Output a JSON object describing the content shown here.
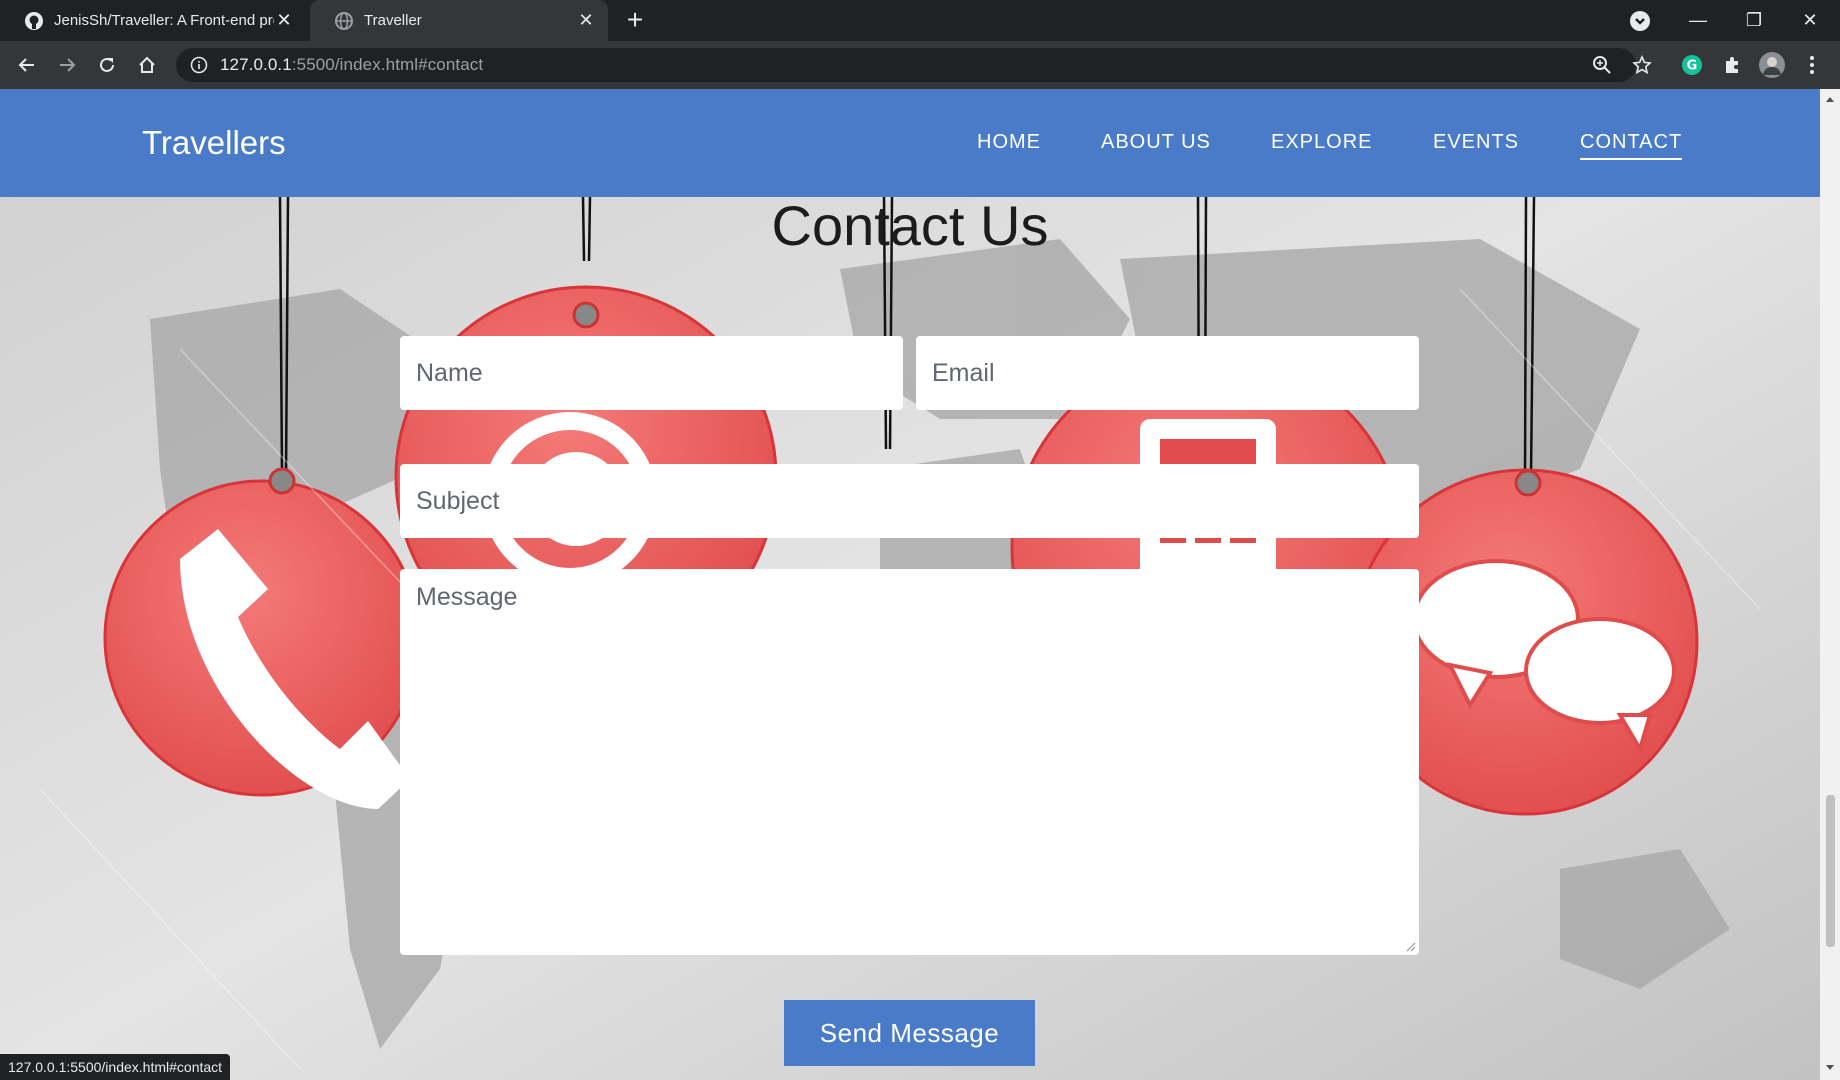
{
  "browser": {
    "tabs": [
      {
        "title": "JenisSh/Traveller: A Front-end pro",
        "active": false
      },
      {
        "title": "Traveller",
        "active": true
      }
    ],
    "url_host": "127.0.0.1",
    "url_rest": ":5500/index.html#contact",
    "status_url": "127.0.0.1:5500/index.html#contact",
    "icons": [
      "github-icon",
      "globe-icon",
      "close-icon",
      "new-tab-icon",
      "back-icon",
      "forward-icon",
      "reload-icon",
      "home-icon",
      "info-icon",
      "zoom-icon",
      "star-icon",
      "grammarly-icon",
      "extensions-icon",
      "profile-avatar",
      "menu-icon"
    ]
  },
  "site": {
    "brand": "Travellers",
    "nav": [
      {
        "label": "HOME"
      },
      {
        "label": "ABOUT US"
      },
      {
        "label": "EXPLORE"
      },
      {
        "label": "EVENTS"
      },
      {
        "label": "CONTACT",
        "active": true
      }
    ],
    "accent": "#4a7bc8"
  },
  "contact": {
    "heading": "Contact Us",
    "name_placeholder": "Name",
    "email_placeholder": "Email",
    "subject_placeholder": "Subject",
    "message_placeholder": "Message",
    "send_label": "Send Message",
    "background_icons": [
      "phone-icon",
      "at-sign-icon",
      "calculator-icon",
      "chat-bubbles-icon"
    ],
    "tag_color": "#e85a5a"
  }
}
